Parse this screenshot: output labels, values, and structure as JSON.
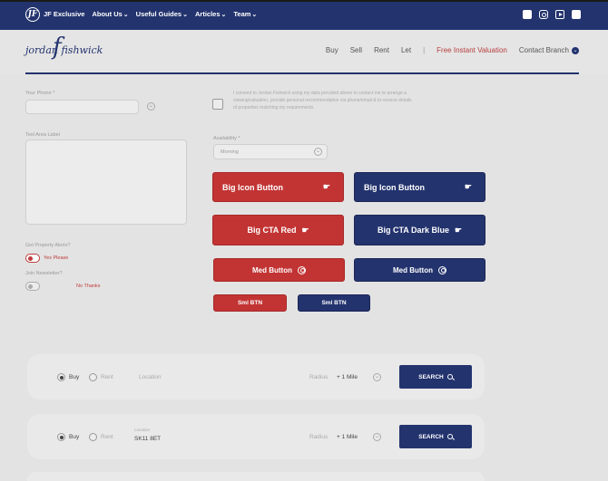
{
  "topbar": {
    "brand": "JF Exclusive",
    "nav": [
      "About Us",
      "Useful Guides",
      "Articles",
      "Team"
    ],
    "socials": [
      "facebook-icon",
      "instagram-icon",
      "youtube-icon",
      "twitter-icon"
    ]
  },
  "header": {
    "logo_text": "jordan fishwick",
    "logo_mark": "f",
    "menu": {
      "buy": "Buy",
      "sell": "Sell",
      "rent": "Rent",
      "let": "Let",
      "separator": "|",
      "valuation": "Free Instant Valuation",
      "contact": "Contact Branch"
    },
    "accent": "#23336e",
    "highlight": "#b84040"
  },
  "form": {
    "phone_label": "Your Phone *",
    "consent_text": "I consent to Jordan Fishwick using my data provided above to contact me to arrange a viewing/valuation, provide personal recommendation via phone/email & to receive details of properties matching my requirements.",
    "text_area_label": "Text Area Label",
    "availability_label": "Availability *",
    "availability_value": "Morning",
    "property_alerts_label": "Get Property Alerts?",
    "property_alerts_on": "Yes Please",
    "newsletter_label": "Join Newsletter?",
    "newsletter_off": "No Thanks"
  },
  "buttons": {
    "big_icon_red": "Big Icon Button",
    "big_icon_blue": "Big Icon Button",
    "big_cta_red": "Big CTA Red",
    "big_cta_blue": "Big CTA Dark Blue",
    "med_red": "Med Button",
    "med_blue": "Med Button",
    "sml_red": "Sml BTN",
    "sml_blue": "Sml BTN",
    "red": "#c23434",
    "blue": "#23336e"
  },
  "search1": {
    "buy": "Buy",
    "rent": "Rent",
    "location_placeholder": "Location",
    "radius_label": "Radius",
    "radius_value": "+ 1 Mile",
    "search": "SEARCH"
  },
  "search2": {
    "buy": "Buy",
    "rent": "Rent",
    "location_label": "Location",
    "location_value": "SK11 8ET",
    "radius_label": "Radius",
    "radius_value": "+ 1 Mile",
    "search": "SEARCH"
  }
}
